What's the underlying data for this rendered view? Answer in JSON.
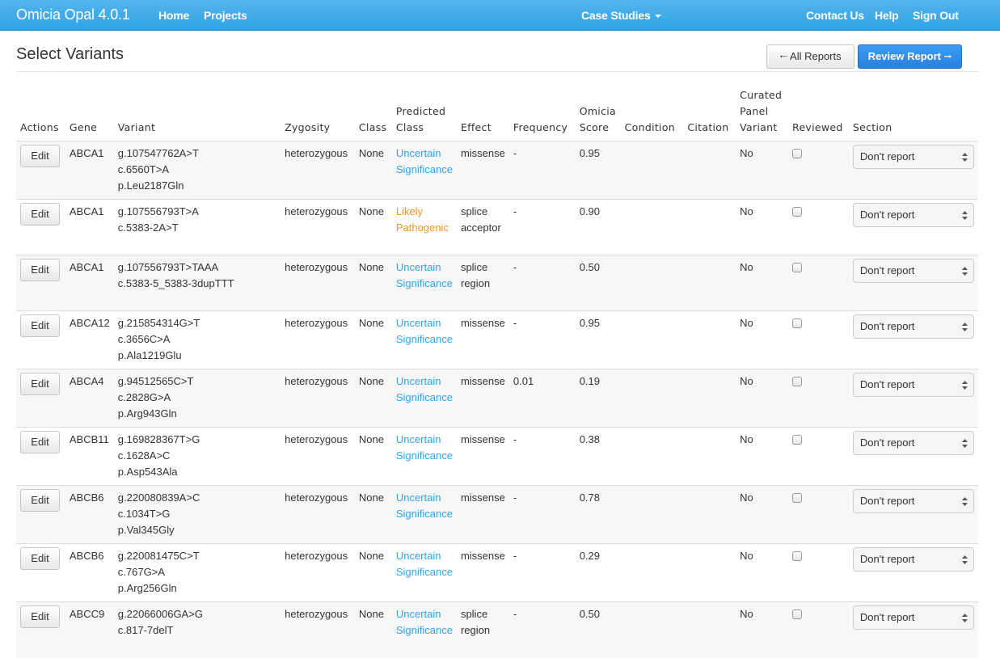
{
  "navbar": {
    "brand": "Omicia Opal 4.0.1",
    "left_links": [
      "Home",
      "Projects"
    ],
    "center_dropdown": "Case Studies",
    "right_links": [
      "Contact Us",
      "Help",
      "Sign Out"
    ],
    "color": "#2fa4e7"
  },
  "page": {
    "title": "Select Variants",
    "all_reports_label": "All Reports",
    "review_report_label": "Review Report",
    "icons": {
      "back": "arrow-left-icon",
      "forward": "arrow-right-icon"
    }
  },
  "table": {
    "headers": {
      "actions": "Actions",
      "gene": "Gene",
      "variant": "Variant",
      "zygosity": "Zygosity",
      "class": "Class",
      "predicted_class_1": "Predicted",
      "predicted_class_2": "Class",
      "effect": "Effect",
      "frequency": "Frequency",
      "omicia_score_1": "Omicia",
      "omicia_score_2": "Score",
      "condition": "Condition",
      "citation": "Citation",
      "curated_1": "Curated",
      "curated_2": "Panel",
      "curated_3": "Variant",
      "reviewed": "Reviewed",
      "section": "Section"
    },
    "edit_label": "Edit",
    "score_colors": {
      "high": "#e61c1c",
      "medium": "#f7941d",
      "low": "#1a7d1a"
    },
    "rows": [
      {
        "gene": "ABCA1",
        "variant": [
          "g.107547762A>T",
          "c.6560T>A",
          "p.Leu2187Gln"
        ],
        "zygosity": "heterozygous",
        "class": "None",
        "predicted_class": [
          "Uncertain",
          "Significance"
        ],
        "predicted_kind": "uncertain",
        "effect": [
          "missense"
        ],
        "frequency": "-",
        "score": "0.95",
        "score_level": "high",
        "condition": "",
        "citation": "",
        "curated": "No",
        "reviewed": false,
        "section": "Don't report"
      },
      {
        "gene": "ABCA1",
        "variant": [
          "g.107556793T>A",
          "c.5383-2A>T",
          ""
        ],
        "zygosity": "heterozygous",
        "class": "None",
        "predicted_class": [
          "Likely",
          "Pathogenic"
        ],
        "predicted_kind": "likely",
        "effect": [
          "splice",
          "acceptor"
        ],
        "frequency": "-",
        "score": "0.90",
        "score_level": "high",
        "condition": "",
        "citation": "",
        "curated": "No",
        "reviewed": false,
        "section": "Don't report"
      },
      {
        "gene": "ABCA1",
        "variant": [
          "g.107556793T>TAAA",
          "c.5383-5_5383-3dupTTT",
          ""
        ],
        "zygosity": "heterozygous",
        "class": "None",
        "predicted_class": [
          "Uncertain",
          "Significance"
        ],
        "predicted_kind": "uncertain",
        "effect": [
          "splice",
          "region"
        ],
        "frequency": "-",
        "score": "0.50",
        "score_level": "medium",
        "condition": "",
        "citation": "",
        "curated": "No",
        "reviewed": false,
        "section": "Don't report"
      },
      {
        "gene": "ABCA12",
        "variant": [
          "g.215854314G>T",
          "c.3656C>A",
          "p.Ala1219Glu"
        ],
        "zygosity": "heterozygous",
        "class": "None",
        "predicted_class": [
          "Uncertain",
          "Significance"
        ],
        "predicted_kind": "uncertain",
        "effect": [
          "missense"
        ],
        "frequency": "-",
        "score": "0.95",
        "score_level": "high",
        "condition": "",
        "citation": "",
        "curated": "No",
        "reviewed": false,
        "section": "Don't report"
      },
      {
        "gene": "ABCA4",
        "variant": [
          "g.94512565C>T",
          "c.2828G>A",
          "p.Arg943Gln"
        ],
        "zygosity": "heterozygous",
        "class": "None",
        "predicted_class": [
          "Uncertain",
          "Significance"
        ],
        "predicted_kind": "uncertain",
        "effect": [
          "missense"
        ],
        "frequency": "0.01",
        "score": "0.19",
        "score_level": "low",
        "condition": "",
        "citation": "",
        "curated": "No",
        "reviewed": false,
        "section": "Don't report"
      },
      {
        "gene": "ABCB11",
        "variant": [
          "g.169828367T>G",
          "c.1628A>C",
          "p.Asp543Ala"
        ],
        "zygosity": "heterozygous",
        "class": "None",
        "predicted_class": [
          "Uncertain",
          "Significance"
        ],
        "predicted_kind": "uncertain",
        "effect": [
          "missense"
        ],
        "frequency": "-",
        "score": "0.38",
        "score_level": "low",
        "condition": "",
        "citation": "",
        "curated": "No",
        "reviewed": false,
        "section": "Don't report"
      },
      {
        "gene": "ABCB6",
        "variant": [
          "g.220080839A>C",
          "c.1034T>G",
          "p.Val345Gly"
        ],
        "zygosity": "heterozygous",
        "class": "None",
        "predicted_class": [
          "Uncertain",
          "Significance"
        ],
        "predicted_kind": "uncertain",
        "effect": [
          "missense"
        ],
        "frequency": "-",
        "score": "0.78",
        "score_level": "medium",
        "condition": "",
        "citation": "",
        "curated": "No",
        "reviewed": false,
        "section": "Don't report"
      },
      {
        "gene": "ABCB6",
        "variant": [
          "g.220081475C>T",
          "c.767G>A",
          "p.Arg256Gln"
        ],
        "zygosity": "heterozygous",
        "class": "None",
        "predicted_class": [
          "Uncertain",
          "Significance"
        ],
        "predicted_kind": "uncertain",
        "effect": [
          "missense"
        ],
        "frequency": "-",
        "score": "0.29",
        "score_level": "low",
        "condition": "",
        "citation": "",
        "curated": "No",
        "reviewed": false,
        "section": "Don't report"
      },
      {
        "gene": "ABCC9",
        "variant": [
          "g.22066006GA>G",
          "c.817-7delT",
          ""
        ],
        "zygosity": "heterozygous",
        "class": "None",
        "predicted_class": [
          "Uncertain",
          "Significance"
        ],
        "predicted_kind": "uncertain",
        "effect": [
          "splice",
          "region"
        ],
        "frequency": "-",
        "score": "0.50",
        "score_level": "medium",
        "condition": "",
        "citation": "",
        "curated": "No",
        "reviewed": false,
        "section": "Don't report"
      }
    ]
  }
}
